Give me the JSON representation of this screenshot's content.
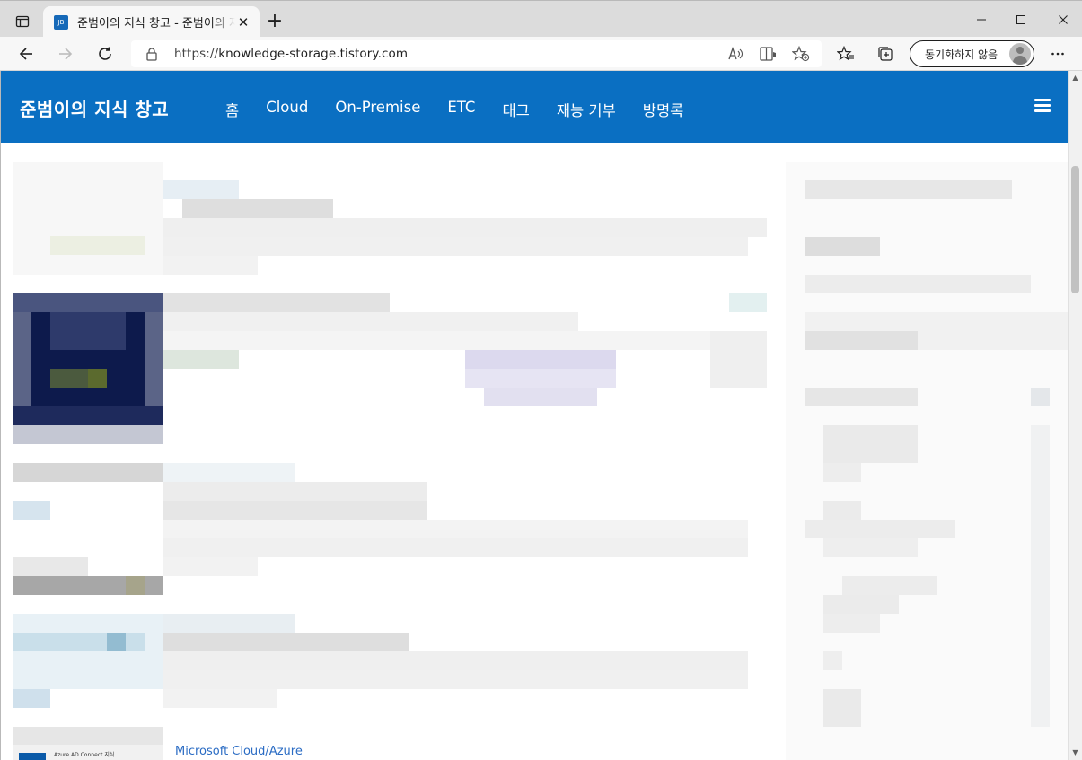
{
  "browser": {
    "tab": {
      "favicon_text": "JB",
      "title": "준범이의 지식 창고 - 준범이의 지식 창고"
    },
    "address": {
      "scheme": "https://",
      "host": "knowledge-storage.tistory.com"
    },
    "sync_label": "동기화하지 않음"
  },
  "blog": {
    "title": "준범이의 지식 창고",
    "nav": [
      "홈",
      "Cloud",
      "On-Premise",
      "ETC",
      "태그",
      "재능 기부",
      "방명록"
    ],
    "bottom_category": "Microsoft Cloud/Azure",
    "bottom_thumb_text": "Azure AD Connect 지식"
  },
  "colors": {
    "header_blue": "#0a6fc2",
    "link_blue": "#2b6cc4",
    "chrome_bg": "#dcdcdc"
  }
}
